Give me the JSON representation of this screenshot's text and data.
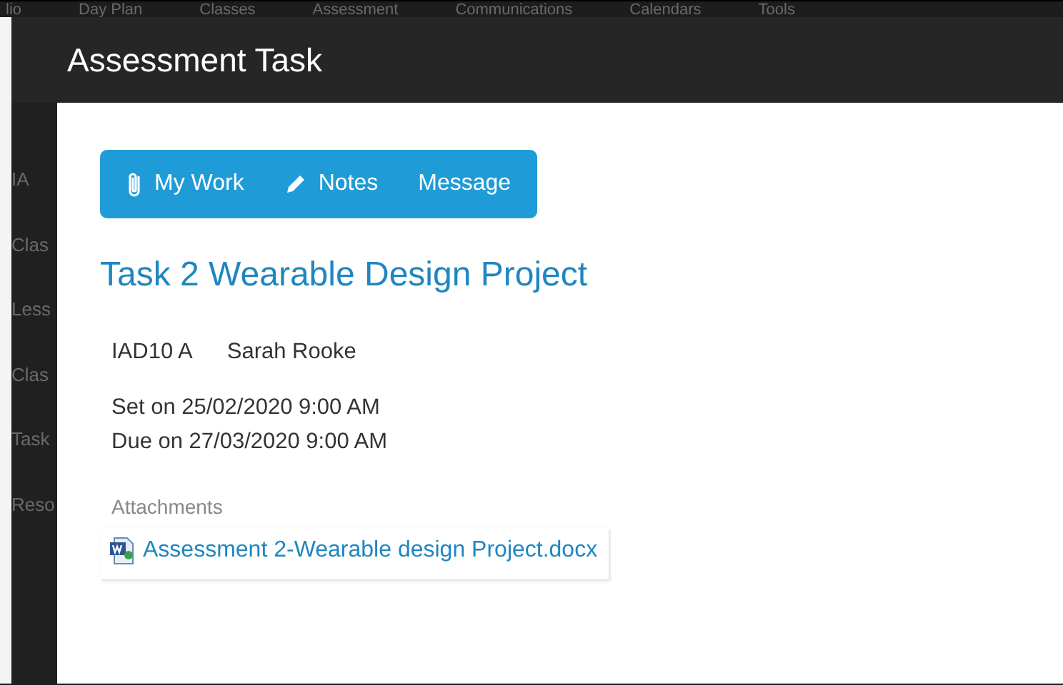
{
  "background": {
    "nav": [
      "lio",
      "Day Plan",
      "Classes",
      "Assessment",
      "Communications",
      "Calendars",
      "Tools"
    ],
    "side_items": [
      "IA",
      "Clas",
      "Less",
      "Clas",
      "Task",
      "Reso"
    ]
  },
  "modal": {
    "title": "Assessment Task",
    "actions": [
      {
        "kind": "paperclip",
        "label": "My Work"
      },
      {
        "kind": "pencil",
        "label": "Notes"
      },
      {
        "kind": "none",
        "label": "Message"
      }
    ],
    "task_title": "Task 2 Wearable Design Project",
    "class": "IAD10 A",
    "teacher": "Sarah Rooke",
    "set_on": "Set on 25/02/2020 9:00 AM",
    "due_on": "Due on 27/03/2020 9:00 AM",
    "attachments_label": "Attachments",
    "attachments": [
      {
        "name": "Assessment 2-Wearable design Project.docx"
      }
    ]
  }
}
